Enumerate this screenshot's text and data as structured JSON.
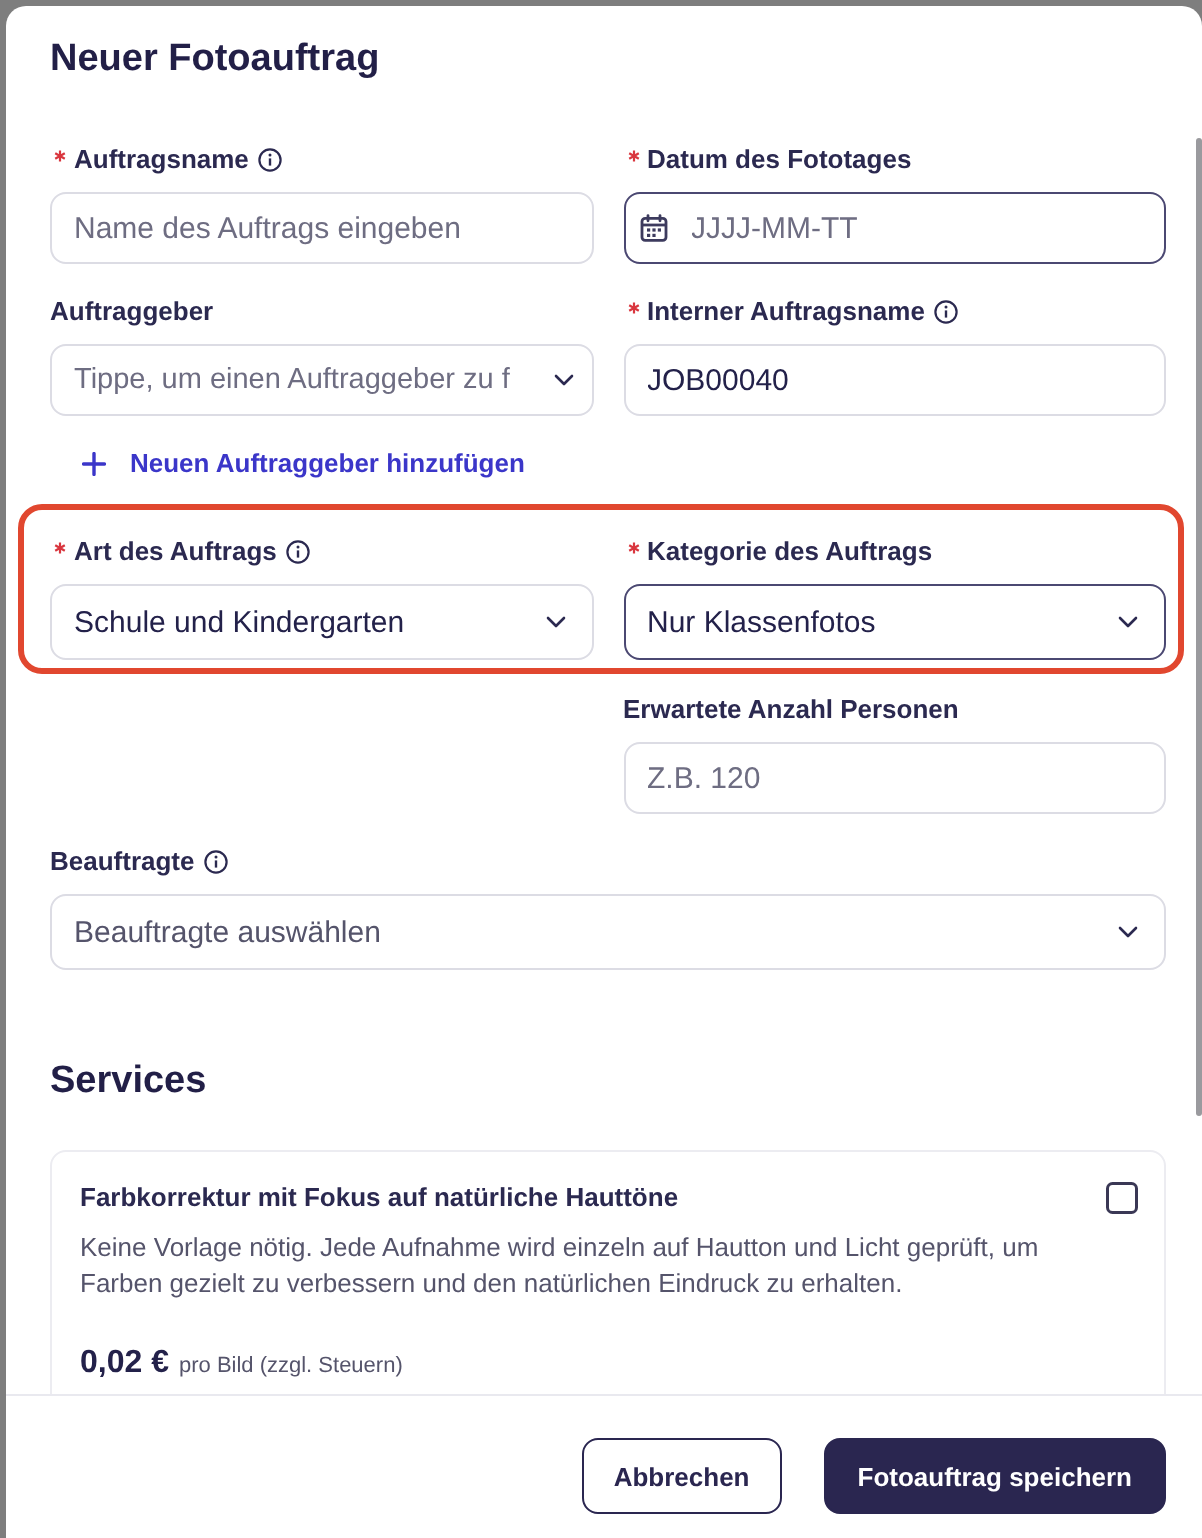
{
  "dialog": {
    "title": "Neuer Fotoauftrag"
  },
  "rows": [
    {
      "highlighted": false,
      "left": {
        "kind": "text",
        "label": "Auftragsname",
        "required": true,
        "info": true,
        "focused": false,
        "placeholder": "Name des Auftrags eingeben"
      },
      "right": {
        "kind": "date",
        "label": "Datum des Fototages",
        "required": true,
        "info": false,
        "focused": true,
        "placeholder": "JJJJ-MM-TT"
      }
    },
    {
      "highlighted": false,
      "left": {
        "kind": "combobox",
        "label": "Auftraggeber",
        "required": false,
        "info": false,
        "focused": false,
        "placeholder": "Tippe, um einen Auftraggeber zu f"
      },
      "right": {
        "kind": "text",
        "label": "Interner Auftragsname",
        "required": true,
        "info": true,
        "focused": false,
        "value": "JOB00040"
      },
      "add_link": {
        "label": "Neuen Auftraggeber hinzufügen"
      }
    },
    {
      "highlighted": true,
      "left": {
        "kind": "select",
        "label": "Art des Auftrags",
        "required": true,
        "info": true,
        "focused": false,
        "value": "Schule und Kindergarten"
      },
      "right": {
        "kind": "select",
        "label": "Kategorie des Auftrags",
        "required": true,
        "info": false,
        "focused": true,
        "value": "Nur Klassenfotos"
      }
    },
    {
      "highlighted": false,
      "right": {
        "kind": "text",
        "label": "Erwartete Anzahl Personen",
        "required": false,
        "info": false,
        "focused": false,
        "placeholder": "Z.B. 120"
      }
    },
    {
      "highlighted": false,
      "wide": {
        "kind": "select",
        "label": "Beauftragte",
        "required": false,
        "info": true,
        "focused": false,
        "placeholder": "Beauftragte auswählen"
      }
    }
  ],
  "services": {
    "title": "Services",
    "items": [
      {
        "name": "Farbkorrektur mit Fokus auf natürliche Hauttöne",
        "checked": false,
        "description": "Keine Vorlage nötig. Jede Aufnahme wird einzeln auf Hautton und Licht geprüft, um Farben gezielt zu verbessern und den natürlichen Eindruck zu erhalten.",
        "price": "0,02 €",
        "price_note": "pro Bild (zzgl. Steuern)"
      }
    ]
  },
  "buttons": [
    {
      "kind": "secondary",
      "label": "Abbrechen"
    },
    {
      "kind": "primary",
      "label": "Fotoauftrag speichern"
    }
  ]
}
